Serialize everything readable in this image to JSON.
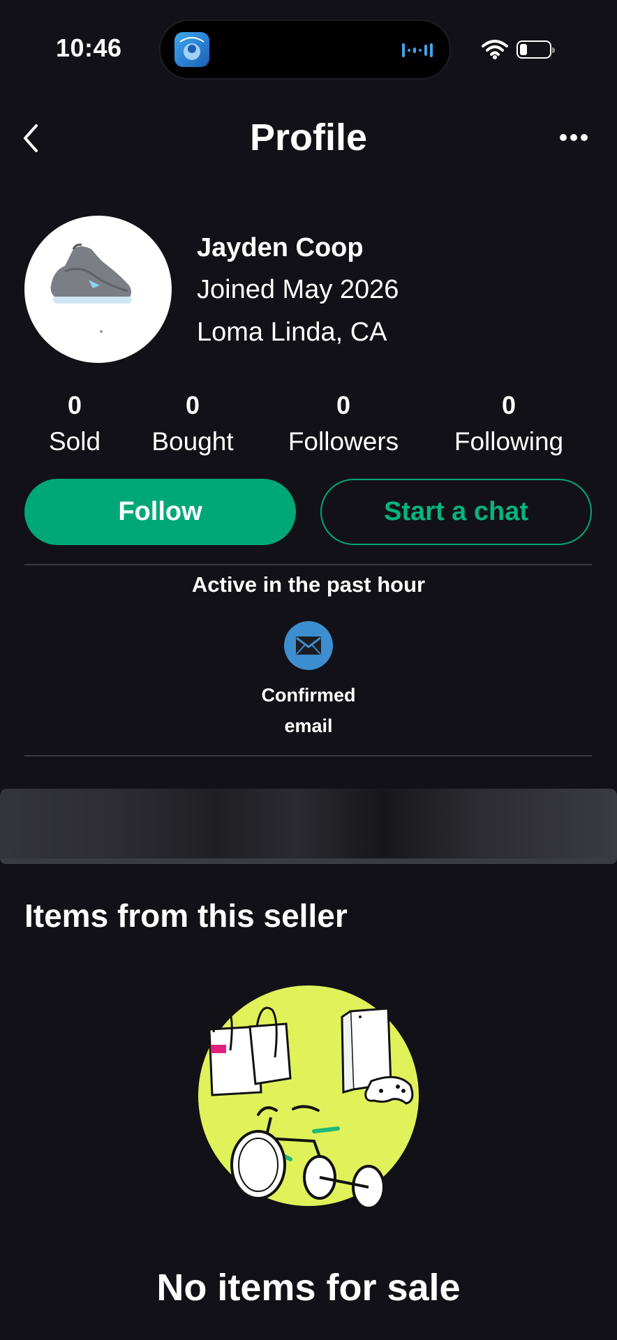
{
  "status_bar": {
    "time": "10:46"
  },
  "header": {
    "title": "Profile"
  },
  "profile": {
    "name": "Jayden Coop",
    "joined": "Joined May 2026",
    "location": "Loma Linda, CA"
  },
  "stats": [
    {
      "value": "0",
      "label": "Sold"
    },
    {
      "value": "0",
      "label": "Bought"
    },
    {
      "value": "0",
      "label": "Followers"
    },
    {
      "value": "0",
      "label": "Following"
    }
  ],
  "actions": {
    "follow_label": "Follow",
    "chat_label": "Start a chat"
  },
  "activity": {
    "status": "Active in the past hour"
  },
  "badges": {
    "email_line1": "Confirmed",
    "email_line2": "email"
  },
  "items": {
    "title": "Items from this seller",
    "empty_text": "No items for sale"
  },
  "colors": {
    "accent": "#00a878",
    "background": "#121117",
    "email_badge": "#3d8ed0",
    "illustration": "#dff25a"
  }
}
